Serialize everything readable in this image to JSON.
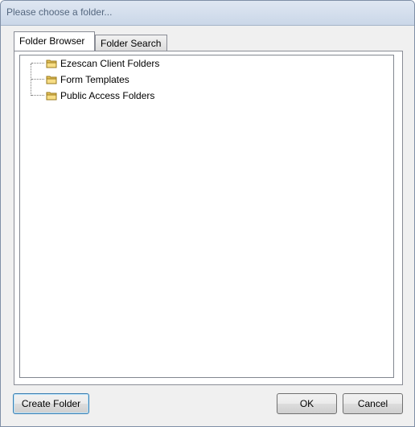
{
  "window": {
    "title": "Please choose a folder..."
  },
  "tabs": [
    {
      "label": "Folder Browser",
      "active": true
    },
    {
      "label": "Folder Search",
      "active": false
    }
  ],
  "tree": {
    "items": [
      {
        "label": "Ezescan Client Folders",
        "icon": "folder-icon"
      },
      {
        "label": "Form Templates",
        "icon": "folder-icon"
      },
      {
        "label": "Public Access Folders",
        "icon": "folder-icon"
      }
    ]
  },
  "buttons": {
    "create_folder": "Create Folder",
    "ok": "OK",
    "cancel": "Cancel"
  }
}
